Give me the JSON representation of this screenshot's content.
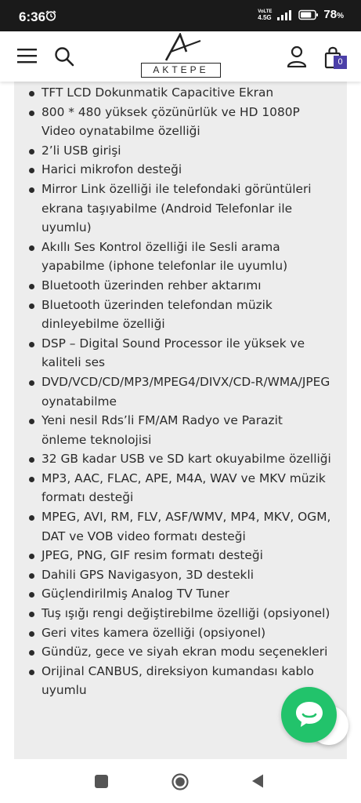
{
  "status_bar": {
    "time": "6:36",
    "network_label": "4.5G",
    "volte_label": "VoLTE",
    "battery_percent": "78",
    "battery_unit": "%",
    "battery_level": 0.78
  },
  "header": {
    "logo_text": "AKTEPE",
    "cart_count": "0"
  },
  "features": [
    "TFT LCD Dokunmatik Capacitive Ekran",
    "800 * 480 yüksek çözünürlük ve HD 1080P Video oynatabilme özelliği",
    "2’li USB girişi",
    "Harici mikrofon desteği",
    "Mirror Link özelliği ile telefondaki görüntüleri ekrana taşıyabilme (Android Telefonlar ile uyumlu)",
    "Akıllı Ses Kontrol özelliği ile Sesli arama yapabilme (iphone telefonlar ile uyumlu)",
    "Bluetooth üzerinden rehber aktarımı",
    "Bluetooth üzerinden telefondan müzik dinleyebilme özelliği",
    "DSP – Digital Sound Processor  ile yüksek ve kaliteli ses",
    "DVD/VCD/CD/MP3/MPEG4/DIVX/CD-R/WMA/JPEG oynatabilme",
    "Yeni nesil Rds’li FM/AM Radyo ve Parazit önleme teknolojisi",
    "32 GB kadar USB ve SD kart okuyabilme özelliği",
    "MP3, AAC, FLAC, APE, M4A, WAV ve MKV müzik formatı desteği",
    "MPEG, AVI, RM, FLV, ASF/WMV, MP4, MKV, OGM, DAT ve VOB video formatı desteği",
    "JPEG, PNG, GIF resim formatı desteği",
    "Dahili GPS Navigasyon, 3D destekli",
    "Güçlendirilmiş Analog TV Tuner",
    "Tuş ışığı rengi değiştirebilme özelliği (opsiyonel)",
    "Geri vites kamera özelliği (opsiyonel)",
    "Gündüz, gece ve siyah ekran modu seçenekleri",
    "Orijinal CANBUS, direksiyon kumandası kablo uyumlu"
  ],
  "icons": {
    "menu": "hamburger-menu-icon",
    "search": "search-icon",
    "user": "user-icon",
    "cart": "shopping-bag-icon",
    "chat": "chat-bubble-icon",
    "nav_recent": "square-recent-apps-icon",
    "nav_home": "circle-home-icon",
    "nav_back": "triangle-back-icon"
  },
  "colors": {
    "status_bar_bg": "#1a1a1a",
    "content_bg": "#ededed",
    "badge_bg": "#4b3fa8",
    "chat_green": "#22c36b",
    "text": "#2b2b2b"
  }
}
